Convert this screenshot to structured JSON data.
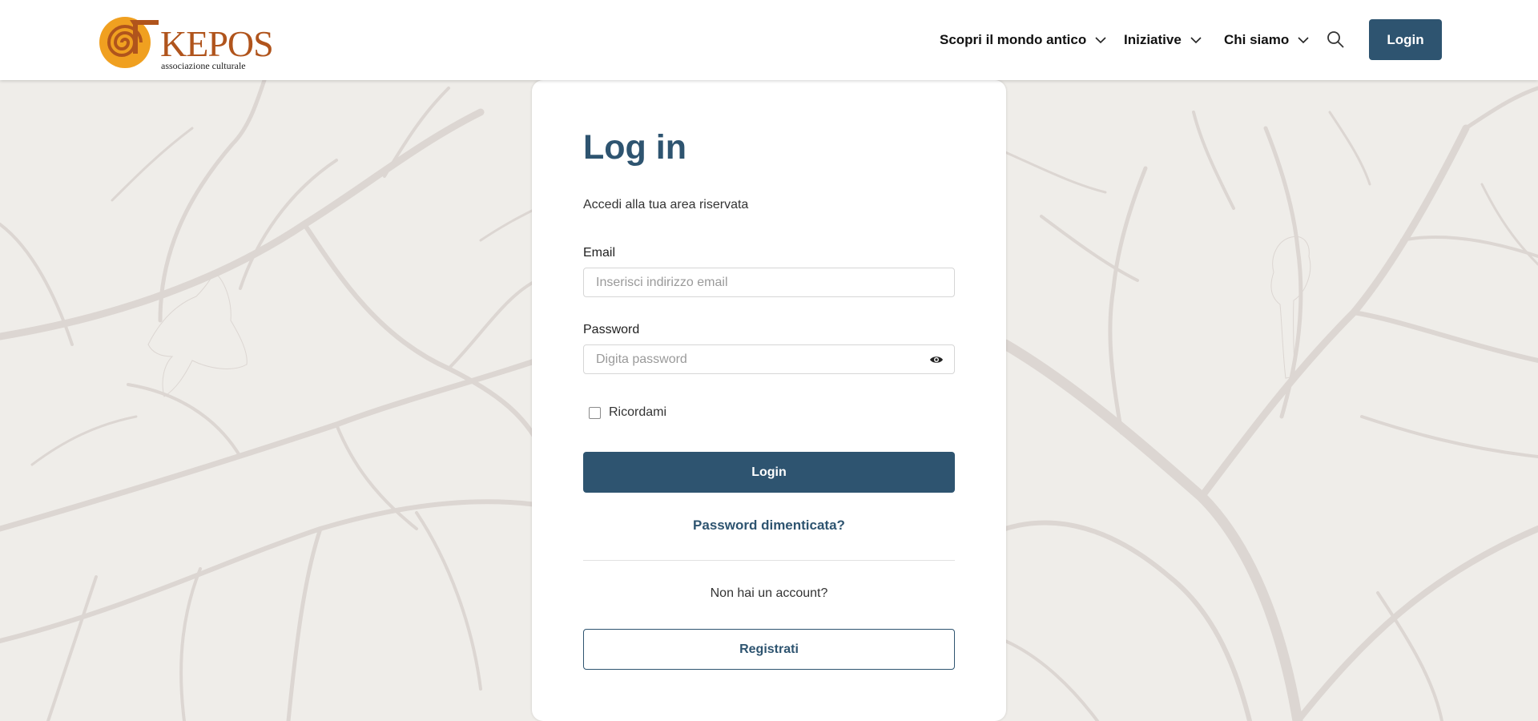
{
  "brand": {
    "name": "KEPOS",
    "tagline": "associazione culturale",
    "color": "#b0541c",
    "accent": "#f0a020"
  },
  "header": {
    "nav": [
      {
        "label": "Scopri il mondo antico",
        "icon": "chevron-down-icon"
      },
      {
        "label": "Iniziative",
        "icon": "chevron-down-icon"
      },
      {
        "label": "Chi siamo",
        "icon": "chevron-down-icon"
      }
    ],
    "search_icon": "search-icon",
    "login_label": "Login"
  },
  "login_form": {
    "title": "Log in",
    "subtitle": "Accedi alla tua area riservata",
    "email": {
      "label": "Email",
      "placeholder": "Inserisci indirizzo email",
      "value": ""
    },
    "password": {
      "label": "Password",
      "placeholder": "Digita password",
      "value": "",
      "toggle_icon": "eye-icon"
    },
    "remember": {
      "label": "Ricordami",
      "checked": false
    },
    "submit_label": "Login",
    "forgot_label": "Password dimenticata?",
    "no_account_text": "Non hai un account?",
    "register_label": "Registrati"
  },
  "colors": {
    "primary": "#2e5470",
    "background": "#efede9",
    "tree_art": "#dcd6d2"
  }
}
